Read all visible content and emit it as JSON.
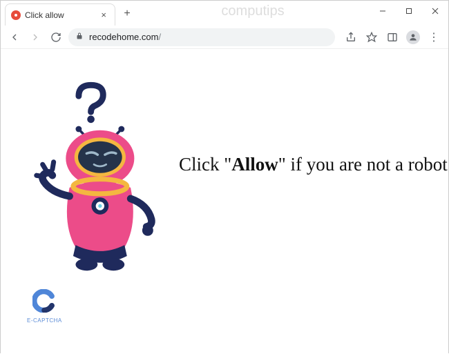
{
  "window": {
    "watermark": "computips"
  },
  "tab": {
    "title": "Click allow"
  },
  "addressbar": {
    "domain": "recodehome.com",
    "path": "/"
  },
  "page": {
    "message_pre": "Click \"",
    "message_allow": "Allow",
    "message_post": "\" if you are not a robot",
    "ecaptcha_label": "E-CAPTCHA"
  },
  "colors": {
    "robot_body": "#ec4c89",
    "robot_dark": "#1f2a5c",
    "robot_visor": "#25334a",
    "robot_yellow": "#f4b740",
    "captcha_blue": "#4f86d8",
    "captcha_navy": "#23356b"
  }
}
